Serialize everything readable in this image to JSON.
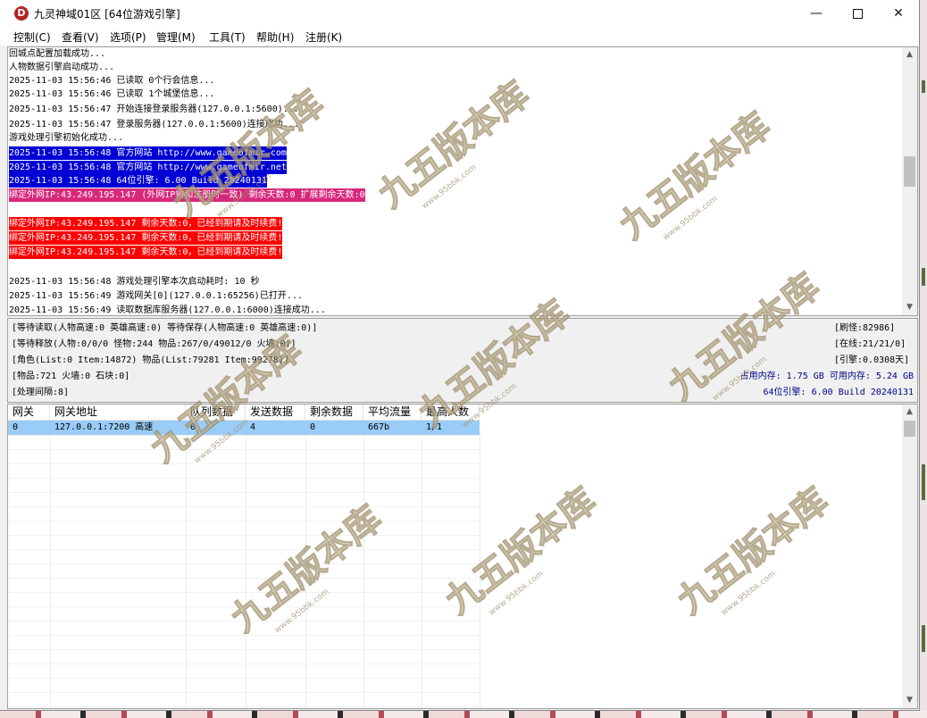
{
  "window": {
    "title": "九灵神域01区 [64位游戏引擎]",
    "icon_letter": "D",
    "minimize": "—",
    "close": "✕"
  },
  "menu": [
    "控制(C)",
    "查看(V)",
    "选项(P)",
    "管理(M)",
    "工具(T)",
    "帮助(H)",
    "注册(K)"
  ],
  "log": [
    {
      "text": "回城点配置加载成功...",
      "style": "plain"
    },
    {
      "text": "人物数据引擎启动成功...",
      "style": "plain"
    },
    {
      "text": "2025-11-03 15:56:46 已读取 0个行会信息...",
      "style": "plain"
    },
    {
      "text": "2025-11-03 15:56:46 已读取 1个城堡信息...",
      "style": "plain"
    },
    {
      "text": "2025-11-03 15:56:47 开始连接登录服务器(127.0.0.1:5600)...",
      "style": "plain"
    },
    {
      "text": "2025-11-03 15:56:47 登录服务器(127.0.0.1:5600)连接成功...",
      "style": "plain"
    },
    {
      "text": "游戏处理引擎初始化成功...",
      "style": "plain"
    },
    {
      "text": "2025-11-03 15:56:48 官方网站 http://www.gameofmir.com",
      "style": "blue"
    },
    {
      "text": "2025-11-03 15:56:48 官方网站 http://www.gameofmir.net",
      "style": "blue"
    },
    {
      "text": "2025-11-03 15:56:48 64位引擎: 6.00 Build 20240131",
      "style": "blue"
    },
    {
      "text": "绑定外网IP:43.249.195.147 (外网IP需和注册时一致) 剩余天数:0 扩展剩余天数:0",
      "style": "magenta"
    },
    {
      "text": "",
      "style": "plain"
    },
    {
      "text": "绑定外网IP:43.249.195.147 剩余天数:0，已经到期请及时续费!",
      "style": "red"
    },
    {
      "text": "绑定外网IP:43.249.195.147 剩余天数:0，已经到期请及时续费!",
      "style": "red"
    },
    {
      "text": "绑定外网IP:43.249.195.147 剩余天数:0，已经到期请及时续费!",
      "style": "red"
    },
    {
      "text": "",
      "style": "plain"
    },
    {
      "text": "2025-11-03 15:56:48 游戏处理引擎本次启动耗时: 10 秒",
      "style": "plain"
    },
    {
      "text": "2025-11-03 15:56:49 游戏网关[0](127.0.0.1:65256)已打开...",
      "style": "plain"
    },
    {
      "text": "2025-11-03 15:56:49 读取数据库服务器(127.0.0.1:6000)连接成功...",
      "style": "plain"
    }
  ],
  "status": {
    "left": [
      "[等待读取(人物高速:0 英雄高速:0) 等待保存(人物高速:0 英雄高速:0)]",
      "[等待释放(人物:0/0/0 怪物:244 物品:267/0/49012/0 火墙:0)]",
      "[角色(List:0 Item:14872) 物品(List:79281 Item:99278)]",
      "[物品:721 火墙:0 石块:0]",
      "[处理间隔:8]"
    ],
    "right_refresh": "[刷怪:82986]",
    "right_online": "[在线:21/21/0]",
    "right_engine": "[引擎:0.0308天]",
    "memory": "占用内存: 1.75 GB 可用内存: 5.24 GB",
    "build": "64位引擎: 6.00 Build 20240131"
  },
  "table": {
    "headers": [
      "网关",
      "网关地址",
      "队列数据",
      "发送数据",
      "剩余数据",
      "平均流量",
      "最高人数"
    ],
    "rows": [
      [
        "0",
        "127.0.0.1:7200 高速",
        "0",
        "4",
        "0",
        "667b",
        "1/1"
      ]
    ]
  },
  "watermark": {
    "text": "九五版本库",
    "subtext": "www.95bbk.com"
  },
  "colors": {
    "highlight_blue": "#0000d4",
    "highlight_magenta": "#d8287c",
    "highlight_red": "#ff0000",
    "selected_row": "#99ccf7",
    "status_blue_text": "#00008b"
  }
}
